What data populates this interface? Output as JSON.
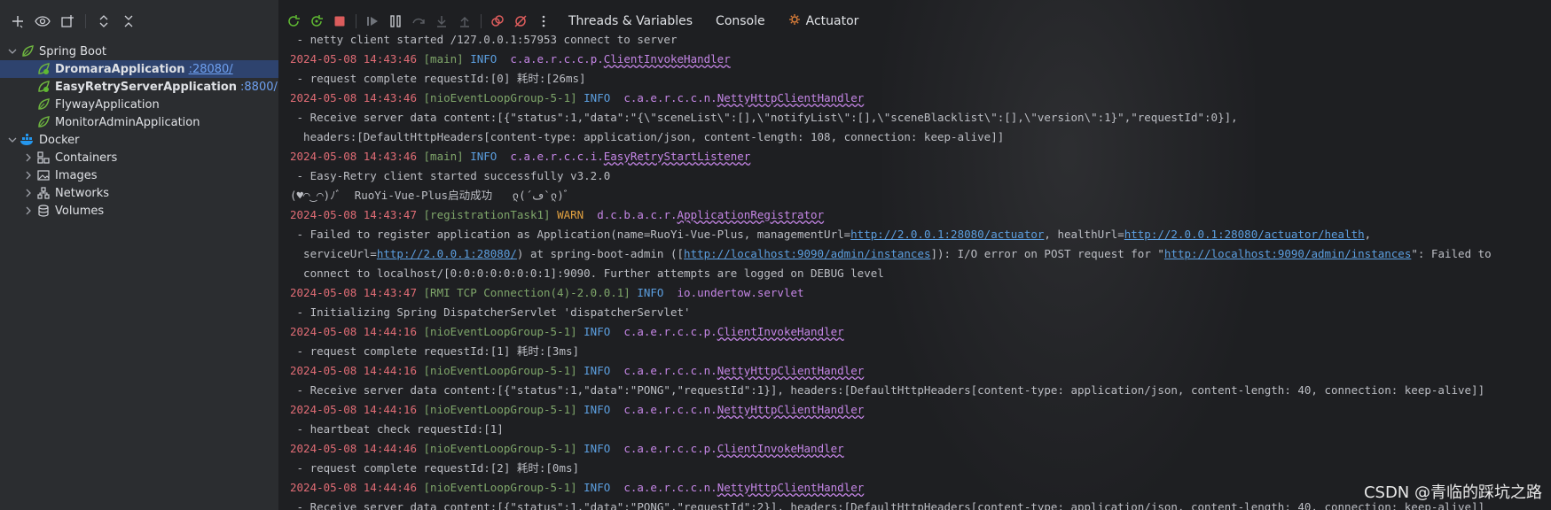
{
  "sidebar": {
    "tree": [
      {
        "label": "Spring Boot",
        "level": 0,
        "expanded": true,
        "icon": "spring-boot-icon"
      },
      {
        "label": "DromaraApplication",
        "port": ":28080/",
        "level": 1,
        "selected": true,
        "bold": true,
        "icon": "spring-run-icon"
      },
      {
        "label": "EasyRetryServerApplication",
        "port": ":8800/",
        "level": 1,
        "bold": true,
        "icon": "spring-run-icon"
      },
      {
        "label": "FlywayApplication",
        "level": 1,
        "icon": "spring-icon"
      },
      {
        "label": "MonitorAdminApplication",
        "level": 1,
        "icon": "spring-icon"
      },
      {
        "label": "Docker",
        "level": 0,
        "expanded": true,
        "icon": "docker-icon"
      },
      {
        "label": "Containers",
        "level": 1,
        "icon": "containers-icon"
      },
      {
        "label": "Images",
        "level": 1,
        "icon": "images-icon"
      },
      {
        "label": "Networks",
        "level": 1,
        "icon": "networks-icon"
      },
      {
        "label": "Volumes",
        "level": 1,
        "icon": "volumes-icon"
      }
    ]
  },
  "toolbar": {
    "tabs": {
      "threads": "Threads & Variables",
      "console": "Console",
      "actuator": "Actuator"
    }
  },
  "console": {
    "lines": [
      {
        "msg": " - netty client started /127.0.0.1:57953 connect to server"
      },
      {
        "ts": "2024-05-08 14:43:46",
        "thread": "[main]",
        "level": "INFO",
        "pkg": "c.a.e.r.c.c.p.",
        "cls": "ClientInvokeHandler"
      },
      {
        "msg": " - request complete requestId:[0] 耗时:[26ms]"
      },
      {
        "ts": "2024-05-08 14:43:46",
        "thread": "[nioEventLoopGroup-5-1]",
        "level": "INFO",
        "pkg": "c.a.e.r.c.c.n.",
        "cls": "NettyHttpClientHandler"
      },
      {
        "msg": " - Receive server data content:[{\"status\":1,\"data\":\"{\\\"sceneList\\\":[],\\\"notifyList\\\":[],\\\"sceneBlacklist\\\":[],\\\"version\\\":1}\",\"requestId\":0}],"
      },
      {
        "msg": "  headers:[DefaultHttpHeaders[content-type: application/json, content-length: 108, connection: keep-alive]]"
      },
      {
        "ts": "2024-05-08 14:43:46",
        "thread": "[main]",
        "level": "INFO",
        "pkg": "c.a.e.r.c.c.i.",
        "cls": "EasyRetryStartListener"
      },
      {
        "msg": " - Easy-Retry client started successfully v3.2.0"
      },
      {
        "msg": "(♥◠‿◠)ﾉﾞ  RuoYi-Vue-Plus启动成功   ლ(´ڡ`ლ)ﾞ"
      },
      {
        "ts": "2024-05-08 14:43:47",
        "thread": "[registrationTask1]",
        "level": "WARN",
        "pkg": "d.c.b.a.c.r.",
        "cls": "ApplicationRegistrator"
      },
      {
        "parts": [
          " - Failed to register application as Application(name=RuoYi-Vue-Plus, managementUrl=",
          {
            "link": "http://2.0.0.1:28080/actuator"
          },
          ", healthUrl=",
          {
            "link": "http://2.0.0.1:28080/actuator/health"
          },
          ","
        ]
      },
      {
        "parts": [
          "  serviceUrl=",
          {
            "link": "http://2.0.0.1:28080/"
          },
          ") at spring-boot-admin ([",
          {
            "link": "http://localhost:9090/admin/instances"
          },
          "]): I/O error on POST request for \"",
          {
            "link": "http://localhost:9090/admin/instances"
          },
          "\": Failed to"
        ]
      },
      {
        "msg": "  connect to localhost/[0:0:0:0:0:0:0:1]:9090. Further attempts are logged on DEBUG level"
      },
      {
        "ts": "2024-05-08 14:43:47",
        "thread": "[RMI TCP Connection(4)-2.0.0.1]",
        "level": "INFO",
        "pkg": "io.undertow.servlet",
        "cls": ""
      },
      {
        "msg": " - Initializing Spring DispatcherServlet 'dispatcherServlet'"
      },
      {
        "ts": "2024-05-08 14:44:16",
        "thread": "[nioEventLoopGroup-5-1]",
        "level": "INFO",
        "pkg": "c.a.e.r.c.c.p.",
        "cls": "ClientInvokeHandler"
      },
      {
        "msg": " - request complete requestId:[1] 耗时:[3ms]"
      },
      {
        "ts": "2024-05-08 14:44:16",
        "thread": "[nioEventLoopGroup-5-1]",
        "level": "INFO",
        "pkg": "c.a.e.r.c.c.n.",
        "cls": "NettyHttpClientHandler"
      },
      {
        "msg": " - Receive server data content:[{\"status\":1,\"data\":\"PONG\",\"requestId\":1}], headers:[DefaultHttpHeaders[content-type: application/json, content-length: 40, connection: keep-alive]]"
      },
      {
        "ts": "2024-05-08 14:44:16",
        "thread": "[nioEventLoopGroup-5-1]",
        "level": "INFO",
        "pkg": "c.a.e.r.c.c.n.",
        "cls": "NettyHttpClientHandler"
      },
      {
        "msg": " - heartbeat check requestId:[1]"
      },
      {
        "ts": "2024-05-08 14:44:46",
        "thread": "[nioEventLoopGroup-5-1]",
        "level": "INFO",
        "pkg": "c.a.e.r.c.c.p.",
        "cls": "ClientInvokeHandler"
      },
      {
        "msg": " - request complete requestId:[2] 耗时:[0ms]"
      },
      {
        "ts": "2024-05-08 14:44:46",
        "thread": "[nioEventLoopGroup-5-1]",
        "level": "INFO",
        "pkg": "c.a.e.r.c.c.n.",
        "cls": "NettyHttpClientHandler"
      },
      {
        "msg": " - Receive server data content:[{\"status\":1,\"data\":\"PONG\",\"requestId\":2}], headers:[DefaultHttpHeaders[content-type: application/json, content-length: 40, connection: keep-alive]]"
      }
    ]
  },
  "watermark": "CSDN @青临的踩坑之路",
  "colors": {
    "timestamp": "#e06c75",
    "thread": "#7fa66a",
    "info": "#5c9fe0",
    "warn": "#e0a040",
    "logger": "#c586e6",
    "selection": "#2e436e"
  }
}
